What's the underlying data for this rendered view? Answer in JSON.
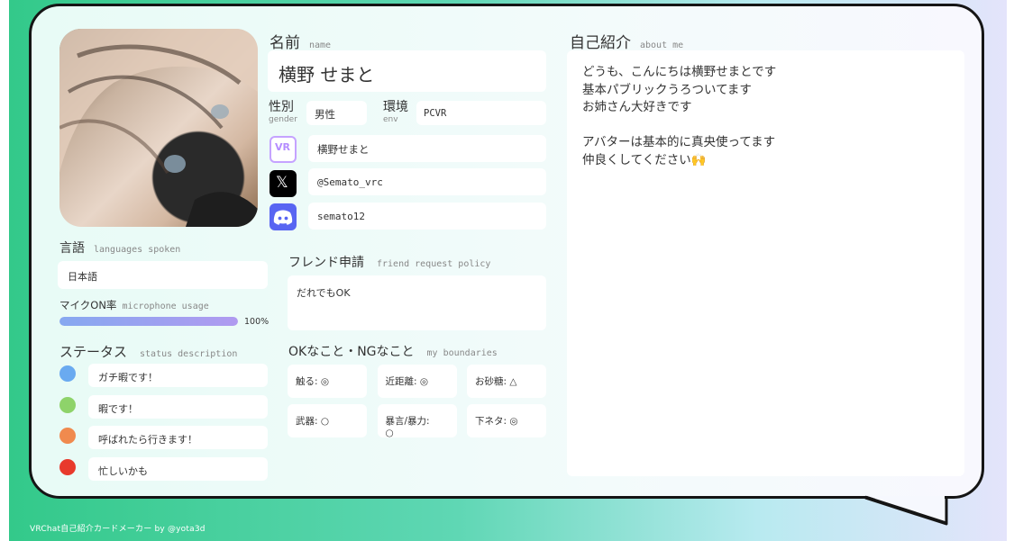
{
  "footer": "VRChat自己紹介カードメーカー by @yota3d",
  "name": {
    "label": "名前",
    "sub": "name",
    "value": "横野 せまと"
  },
  "gender": {
    "label": "性別",
    "sub": "gender",
    "value": "男性"
  },
  "env": {
    "label": "環境",
    "sub": "env",
    "value": "PCVR"
  },
  "vrchat_name": "横野せまと",
  "x_handle": "@Semato_vrc",
  "discord": "semato12",
  "icons": {
    "vr": "vrchat-icon",
    "x": "x-logo-icon",
    "discord": "discord-icon",
    "vr_text": "VR",
    "x_text": "𝕏"
  },
  "languages": {
    "label": "言語",
    "sub": "languages spoken",
    "value": "日本語"
  },
  "mic": {
    "label": "マイクON率",
    "sub": "microphone usage",
    "percent": 100,
    "percent_text": "100%"
  },
  "status": {
    "label": "ステータス",
    "sub": "status description",
    "items": [
      {
        "color": "#6aaaf0",
        "text": "ガチ暇です！"
      },
      {
        "color": "#8ed36a",
        "text": "暇です！"
      },
      {
        "color": "#f08a4e",
        "text": "呼ばれたら行きます！"
      },
      {
        "color": "#e83a2c",
        "text": "忙しいかも"
      }
    ]
  },
  "friend": {
    "label": "フレンド申請",
    "sub": "friend request policy",
    "value": "だれでもOK"
  },
  "boundaries": {
    "label": "OKなこと・NGなこと",
    "sub": "my boundaries",
    "items": [
      "触る: ◎",
      "近距離: ◎",
      "お砂糖: △",
      "武器: ○",
      "暴言/暴力:\n○",
      "下ネタ: ◎"
    ]
  },
  "about": {
    "label": "自己紹介",
    "sub": "about me",
    "text": "どうも、こんにちは横野せまとです\n基本パブリックうろついてます\nお姉さん大好きです\n\nアバターは基本的に真央使ってます\n仲良くしてください🙌"
  }
}
